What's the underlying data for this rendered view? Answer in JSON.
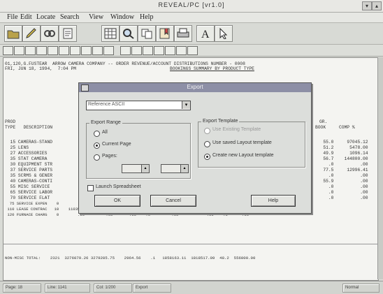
{
  "window": {
    "title": "REVEAL/PC  [vr1.0]"
  },
  "menu": [
    "File",
    "Edit",
    "Locate",
    "Search",
    "View",
    "Window",
    "Help"
  ],
  "toolbar2_labels": [
    "",
    "",
    "",
    "",
    "",
    "",
    "",
    "",
    "",
    "",
    "",
    "",
    "",
    "",
    "",
    "",
    ""
  ],
  "report": {
    "header1": "01,120,G.FUSTEAR  ARROW CAMERA COMPANY -- ORDER REVENUE/ACCOUNT DISTRIBUTIONS NUMBER - 0008",
    "header2": "FRI, JUN 18, 1994,  7:04 PM",
    "header2b": "BOOKINGS SUMMARY BY PRODUCT TYPE",
    "col_head1": "PROD",
    "col_head2": "TYPE   DESCRIPTION",
    "col_head_right1": "GR.",
    "col_head_right2": "BOOK     COMP %",
    "rows": [
      "  15 CAMERAS-STAND",
      "  25 LENS",
      "  27 ACCESSORIES",
      "  35 STAT CAMERA",
      "  30 EQUIPMENT STR",
      "  37 SERVICE PARTS",
      "  35 SCRMS & GENER",
      "  40 CAMERAS-CONTI",
      "  55 MISC SERVICE",
      "  65 SERVICE LABOR",
      "  70 SERVICE FLAT",
      "  75 SERVICE EXPEN    0        .00         .00       .00    .0         .00            .00    .0      .00",
      " 110 LEASE CONTRAC   10    11035.82        .00  -11035-48-100.0     11035.48          .00    .0      .00",
      " 120 FURNACE CHARG    0        .00         .00       .00    .0         .00            .00    .0      .00"
    ],
    "right_cols": [
      "   55.0     97045.12",
      "   51.2      5478.00",
      "   49.9      1096.14",
      "   56.7    144800.00",
      "     .0          .00",
      "   77.5     12996.41",
      "     .0          .00",
      "   55.9          .00",
      "     .0          .00",
      "     .0          .00",
      "     .0          .00"
    ],
    "total": "NON-MISC TOTAL:    2321  3276079.26 3279285.75    2964.56    .1   1858163.11  1818517.09  48.2  556000.00"
  },
  "dialog": {
    "title": "Export",
    "combo_value": "Reference ASCII",
    "export_range_label": "Export Range",
    "range_all": "All",
    "range_current": "Current Page",
    "range_pages": "Pages:",
    "template_label": "Export Template",
    "tmpl_use": "Use Existing Template",
    "tmpl_saved": "Use saved Layout template",
    "tmpl_create": "Create new Layout template",
    "launch": "Launch Spreadsheet",
    "ok": "OK",
    "cancel": "Cancel",
    "help": "Help"
  },
  "status": {
    "page": "Page: 18",
    "line": "Line: 1141",
    "col": "Col: 1/200",
    "mode": "Export",
    "right": "Normal"
  }
}
